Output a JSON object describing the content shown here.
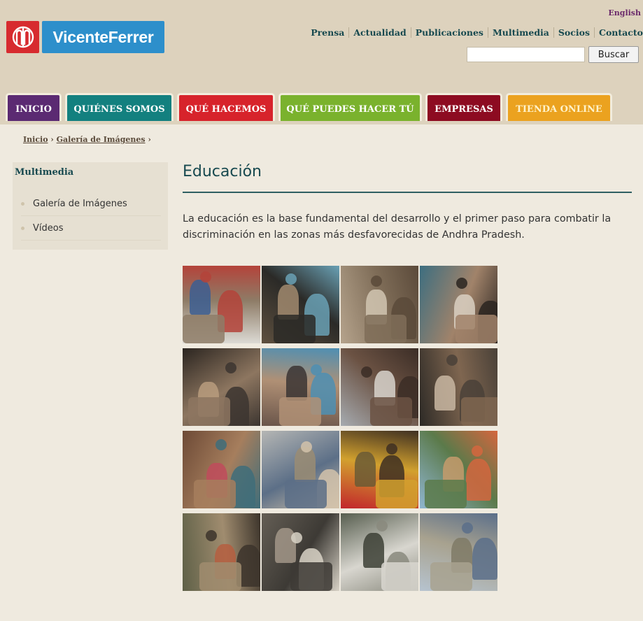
{
  "brand": {
    "name": "VicenteFerrer",
    "colors": {
      "logo_red": "#d72b2f",
      "logo_blue": "#2d8fcb"
    }
  },
  "language_link": "English",
  "topnav": [
    "Prensa",
    "Actualidad",
    "Publicaciones",
    "Multimedia",
    "Socios",
    "Contacto"
  ],
  "search": {
    "button_label": "Buscar",
    "value": ""
  },
  "mainnav": [
    {
      "label": "INICIO",
      "color": "#5b2a72"
    },
    {
      "label": "QUIÉNES SOMOS",
      "color": "#13807f"
    },
    {
      "label": "QUÉ HACEMOS",
      "color": "#d7232b"
    },
    {
      "label": "QUÉ PUEDES HACER TÚ",
      "color": "#7ab22d"
    },
    {
      "label": "EMPRESAS",
      "color": "#8d0b21"
    },
    {
      "label": "TIENDA ONLINE",
      "color": "#eba21f"
    }
  ],
  "breadcrumb": {
    "home": "Inicio",
    "gallery": "Galería de Imágenes",
    "sep": "›"
  },
  "sidebar": {
    "title": "Multimedia",
    "items": [
      {
        "label": "Galería de Imágenes"
      },
      {
        "label": "Vídeos"
      }
    ]
  },
  "main": {
    "title": "Educación",
    "intro": "La educación es la base fundamental del desarrollo y el primer paso para combatir la discriminación en las zonas más desfavorecidas de Andhra Pradesh."
  },
  "gallery": {
    "photos": [
      {
        "name": "schoolchildren-backpacks-photo",
        "palette": [
          "#dcdad4",
          "#8e7c67",
          "#3c5e92",
          "#b4433a"
        ]
      },
      {
        "name": "children-slates-photo",
        "palette": [
          "#5e503f",
          "#2b2a27",
          "#a18a6f",
          "#6aa1b5"
        ]
      },
      {
        "name": "classroom-floor-photo",
        "palette": [
          "#b5a38c",
          "#7f6d58",
          "#d1c5b2",
          "#5b4a3a"
        ]
      },
      {
        "name": "girl-classroom-photo",
        "palette": [
          "#3d6e80",
          "#a1836a",
          "#d9d0c2",
          "#2a2420"
        ]
      },
      {
        "name": "teacher-with-book-photo",
        "palette": [
          "#2b2520",
          "#8d7660",
          "#b99c7e",
          "#3c3530"
        ]
      },
      {
        "name": "teacher-group-photo",
        "palette": [
          "#6a554a",
          "#b09075",
          "#3b3534",
          "#4e8fb3"
        ]
      },
      {
        "name": "man-writing-photo",
        "palette": [
          "#a6abb0",
          "#6b5243",
          "#d8d4cd",
          "#3b2d26"
        ]
      },
      {
        "name": "students-studying-photo",
        "palette": [
          "#2d2a26",
          "#7f6650",
          "#c9b7a2",
          "#4a4138"
        ]
      },
      {
        "name": "children-with-slates-photo",
        "palette": [
          "#6d4a36",
          "#a67e5d",
          "#c04b5c",
          "#3e6d7a"
        ]
      },
      {
        "name": "outdoor-children-photo",
        "palette": [
          "#b5b6b4",
          "#5c6f87",
          "#9a8c73",
          "#d2c2aa"
        ]
      },
      {
        "name": "dance-performance-photo",
        "palette": [
          "#c2262c",
          "#d2a12e",
          "#6b5a35",
          "#3e2f22"
        ]
      },
      {
        "name": "field-playground-photo",
        "palette": [
          "#8fb5d0",
          "#5b7a4a",
          "#c69b6c",
          "#d4663e"
        ]
      },
      {
        "name": "teacher-pointing-photo",
        "palette": [
          "#5e6047",
          "#a08c6f",
          "#b55e40",
          "#3c342b"
        ]
      },
      {
        "name": "students-in-class-photo",
        "palette": [
          "#645e55",
          "#3d3a35",
          "#a29788",
          "#d8d2c6"
        ]
      },
      {
        "name": "children-writing-photo",
        "palette": [
          "#575e4f",
          "#d8d6cf",
          "#3c3f35",
          "#8a8a7e"
        ]
      },
      {
        "name": "girls-on-bicycles-photo",
        "palette": [
          "#b6c3cf",
          "#a8a28f",
          "#7f7a66",
          "#5b6f8a"
        ]
      }
    ]
  }
}
